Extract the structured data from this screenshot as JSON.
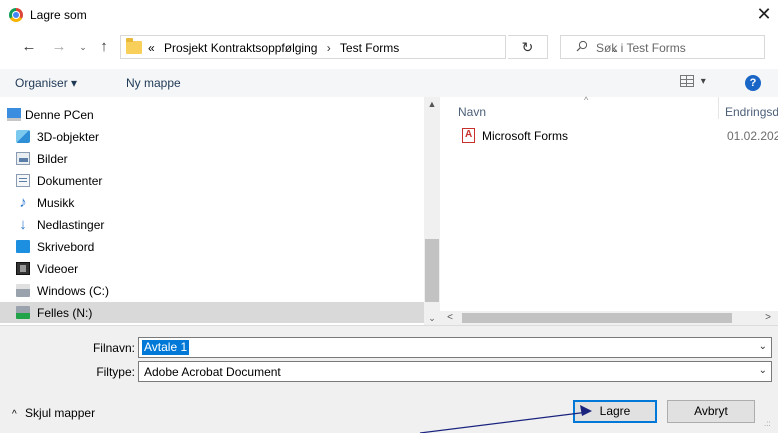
{
  "window": {
    "title": "Lagre som",
    "close_glyph": "✕",
    "icon": "chrome-icon"
  },
  "nav": {
    "back_glyph": "←",
    "forward_glyph": "→",
    "recent_glyph": "⌄",
    "up_glyph": "↑",
    "breadcrumb_prefix": "«",
    "breadcrumbs": [
      "Prosjekt Kontraktsoppfølging",
      "Test Forms"
    ],
    "breadcrumb_sep": "›",
    "dropdown_glyph": "⌄",
    "refresh_glyph": "↻",
    "search_placeholder": "Søk i Test Forms"
  },
  "toolbar": {
    "organize": "Organiser ▾",
    "new_folder": "Ny mappe",
    "view_caret": "▾",
    "help_glyph": "?"
  },
  "tree": [
    {
      "label": "Denne PCen",
      "icon": "pc-icon",
      "selected": false
    },
    {
      "label": "3D-objekter",
      "icon": "3d-objects-icon",
      "selected": false
    },
    {
      "label": "Bilder",
      "icon": "pictures-icon",
      "selected": false
    },
    {
      "label": "Dokumenter",
      "icon": "documents-icon",
      "selected": false
    },
    {
      "label": "Musikk",
      "icon": "music-icon",
      "selected": false
    },
    {
      "label": "Nedlastinger",
      "icon": "downloads-icon",
      "selected": false
    },
    {
      "label": "Skrivebord",
      "icon": "desktop-icon",
      "selected": false
    },
    {
      "label": "Videoer",
      "icon": "videos-icon",
      "selected": false
    },
    {
      "label": "Windows (C:)",
      "icon": "drive-icon",
      "selected": false
    },
    {
      "label": "Felles (N:)",
      "icon": "network-drive-icon",
      "selected": true
    }
  ],
  "files": {
    "columns": {
      "name": "Navn",
      "date": "Endringsd",
      "sort_glyph": "^"
    },
    "rows": [
      {
        "name": "Microsoft Forms",
        "date": "01.02.202",
        "icon": "pdf-icon"
      }
    ]
  },
  "scroll": {
    "up": "▲",
    "down": "⌄",
    "left": "<",
    "right": ">"
  },
  "form": {
    "filename_label": "Filnavn:",
    "filename_value": "Avtale 1",
    "filetype_label": "Filtype:",
    "filetype_value": "Adobe Acrobat Document",
    "dropdown_glyph": "⌄"
  },
  "footer": {
    "hide_folders": "Skjul mapper",
    "hide_chevron": "^",
    "save": "Lagre",
    "cancel": "Avbryt",
    "grip": ".::"
  },
  "colors": {
    "selection": "#0078d7",
    "annotation": "#1a237e"
  }
}
